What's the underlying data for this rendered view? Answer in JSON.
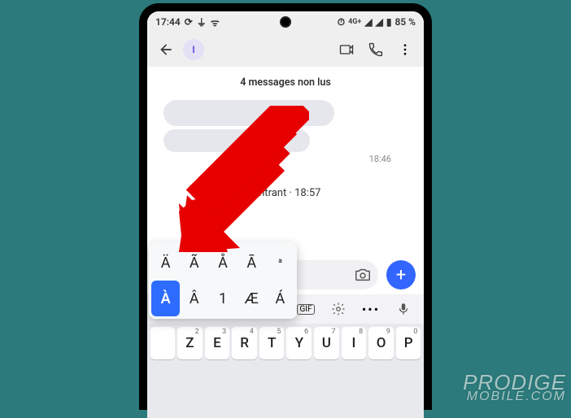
{
  "status": {
    "time": "17:44",
    "network_badge": "4G+",
    "battery": "85 %",
    "icons_left": [
      "sync-icon",
      "usb-icon",
      "wifi-icon"
    ],
    "icons_right": [
      "alarm-icon",
      "4g-icon",
      "signal-icon",
      "signal-icon",
      "battery-icon"
    ]
  },
  "appbar": {
    "avatar_initial": "I"
  },
  "content": {
    "unread_text": "4 messages non lus",
    "msg_time": "18:46",
    "call_text": "Appel vocal entrant · 18:57"
  },
  "compose": {
    "camera_name": "camera-icon",
    "plus_label": "+"
  },
  "popup": {
    "row1": [
      "Ä",
      "Ã",
      "Å",
      "Ā",
      "ª"
    ],
    "row2": [
      "À",
      "Â",
      "1",
      "Æ",
      "Á"
    ],
    "selected": "À"
  },
  "keyboard": {
    "row1": [
      {
        "k": "",
        "s": ""
      },
      {
        "k": "Z",
        "s": "2"
      },
      {
        "k": "E",
        "s": "3"
      },
      {
        "k": "R",
        "s": "4"
      },
      {
        "k": "T",
        "s": "5"
      },
      {
        "k": "Y",
        "s": "6"
      },
      {
        "k": "U",
        "s": "7"
      },
      {
        "k": "I",
        "s": "8"
      },
      {
        "k": "O",
        "s": "9"
      },
      {
        "k": "P",
        "s": "0"
      }
    ]
  },
  "suggestions_icons": [
    "gif-icon",
    "settings-icon",
    "more-icon",
    "mic-icon"
  ],
  "watermark": {
    "line1": "PRODIGE",
    "line2": "MOBILE.COM"
  }
}
